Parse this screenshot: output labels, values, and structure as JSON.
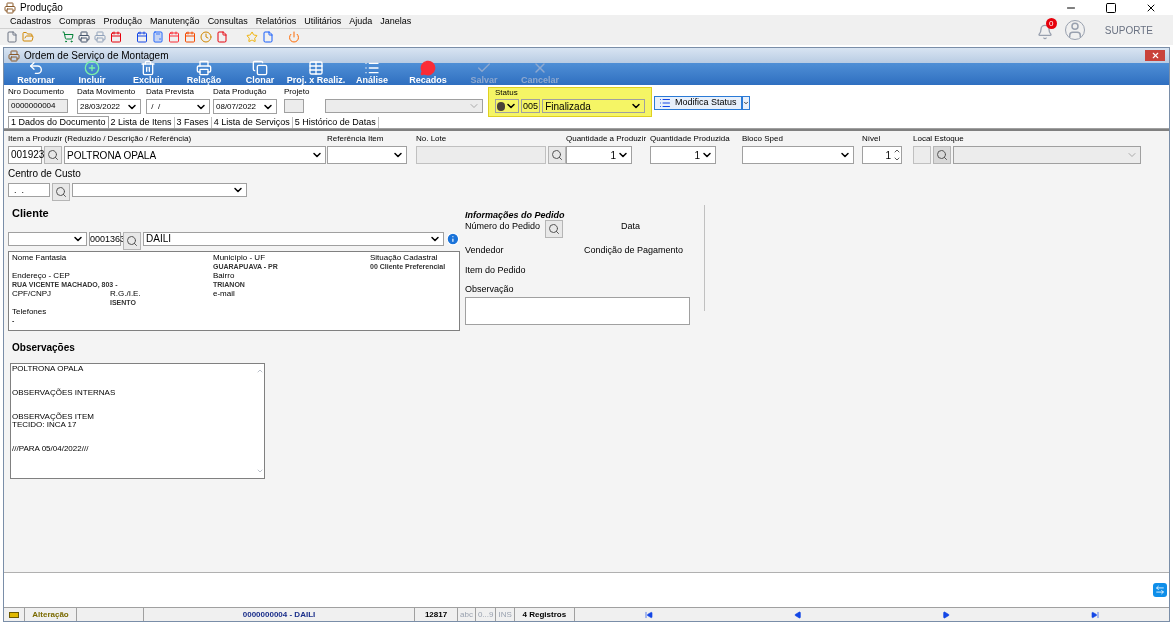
{
  "app": {
    "title": "Produção"
  },
  "menu": [
    "Cadastros",
    "Compras",
    "Produção",
    "Manutenção",
    "Consultas",
    "Relatórios",
    "Utilitários",
    "Ajuda",
    "Janelas"
  ],
  "top_right": {
    "notifications": "0",
    "user": "SUPORTE"
  },
  "window": {
    "title": "Ordem de Serviço de Montagem"
  },
  "ribbon": [
    {
      "label": "Retornar",
      "kind": "undo",
      "disabled": false
    },
    {
      "label": "Incluir",
      "kind": "add",
      "disabled": false
    },
    {
      "label": "Excluir",
      "kind": "delete",
      "disabled": false
    },
    {
      "label": "Relação",
      "kind": "print",
      "disabled": false
    },
    {
      "label": "Clonar",
      "kind": "clone",
      "disabled": false
    },
    {
      "label": "Proj. x Realiz.",
      "kind": "grid",
      "disabled": false
    },
    {
      "label": "Análise",
      "kind": "list",
      "disabled": false
    },
    {
      "label": "Recados",
      "kind": "message",
      "disabled": false
    },
    {
      "label": "Salvar",
      "kind": "check",
      "disabled": true
    },
    {
      "label": "Cancelar",
      "kind": "cancel",
      "disabled": true
    }
  ],
  "header_fields": [
    {
      "label": "Nro Documento",
      "value": "0000000004",
      "kind": "readonly"
    },
    {
      "label": "Data Movimento",
      "value": "28/03/2022",
      "kind": "combo"
    },
    {
      "label": "Data Prevista",
      "value": " /  /",
      "kind": "combo"
    },
    {
      "label": "Data Produção",
      "value": "08/07/2022",
      "kind": "combo"
    },
    {
      "label": "Projeto",
      "kind": "small"
    },
    {
      "kind": "disabled-combo"
    }
  ],
  "status": {
    "label": "Status",
    "code": "005",
    "value": "Finalizada",
    "highlighted": true
  },
  "modify_status_button": "Modifica Status",
  "tabs": [
    {
      "label": "1 Dados do Documento",
      "selected": true
    },
    {
      "label": "2 Lista de Itens",
      "selected": false
    },
    {
      "label": "3 Fases",
      "selected": false
    },
    {
      "label": "4 Lista de Serviços",
      "selected": false
    },
    {
      "label": "5 Histórico de Datas",
      "selected": false
    }
  ],
  "item_fields": [
    {
      "label": "Item a Produzir (Reduzido / Descrição / Referência)",
      "code": "001923",
      "value": "POLTRONA OPALA",
      "kind": "code-combo"
    },
    {
      "label": "Referência Item",
      "kind": "combo"
    },
    {
      "label": "No. Lote",
      "kind": "lookup"
    },
    {
      "label": "Quantidade a Produzir",
      "value": "1",
      "kind": "number"
    },
    {
      "label": "Quantidade Produzida",
      "value": "1",
      "kind": "number"
    },
    {
      "label": "Bloco Sped",
      "kind": "combo"
    },
    {
      "label": "Nível",
      "value": "1",
      "kind": "spinner"
    },
    {
      "label": "Local Estoque",
      "kind": "disabled-lookup"
    }
  ],
  "cost_center": {
    "label": "Centro de Custo",
    "value": "  .  ."
  },
  "client": {
    "heading": "Cliente",
    "code": "0001363",
    "name": "DAILI",
    "details": [
      {
        "label": "Nome Fantasia"
      },
      {
        "label": "Município - UF",
        "value": "GUARAPUAVA - PR"
      },
      {
        "label": "Situação Cadastral",
        "value": "00 Cliente Preferencial"
      },
      {
        "label": "Endereço - CEP",
        "value": "RUA VICENTE MACHADO, 803 -"
      },
      {
        "label": "Bairro",
        "value": "TRIANON"
      },
      {
        "label": "CPF/CNPJ"
      },
      {
        "label": "R.G./I.E.",
        "value": "ISENTO"
      },
      {
        "label": "e-mail"
      },
      {
        "label": "Telefones",
        "value": "-"
      }
    ]
  },
  "order_info": {
    "heading": "Informações do Pedido",
    "order_number": "Número do Pedido",
    "date": "Data",
    "seller": "Vendedor",
    "payment": "Condição de Pagamento",
    "item": "Item do Pedido",
    "note": "Observação"
  },
  "observations": {
    "heading": "Observações",
    "text": "POLTRONA OPALA\n\n\nOBSERVAÇÕES INTERNAS\n\n\nOBSERVAÇÕES ITEM\nTECIDO: INCA 17\n\n\n///PARA 05/04/2022///"
  },
  "status_bar": {
    "mode": "Alteração",
    "record": "0000000004 - DAILI",
    "number": "12817",
    "indicators": [
      "abc",
      "0...9",
      "INS"
    ],
    "count": "4 Registros"
  }
}
